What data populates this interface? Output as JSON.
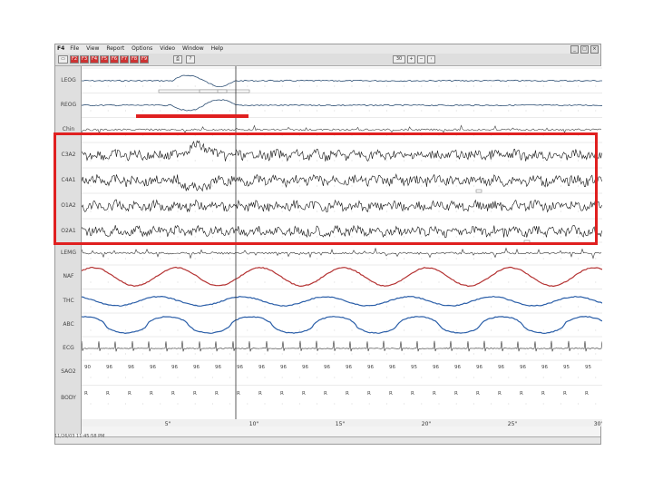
{
  "menu": {
    "app": "F4",
    "items": [
      "File",
      "View",
      "Report",
      "Options",
      "Video",
      "Window",
      "Help"
    ]
  },
  "toolbar": {
    "buttons": [
      "F2",
      "F3",
      "F4",
      "F5",
      "F6",
      "F7",
      "F8",
      "F9"
    ],
    "zoom_label": "30"
  },
  "channels": [
    {
      "label": "LEOG",
      "color": "#2c4e73"
    },
    {
      "label": "REOG",
      "color": "#2c4e73"
    },
    {
      "label": "Chin",
      "color": "#444444"
    },
    {
      "label": "C3A2",
      "color": "#111111"
    },
    {
      "label": "C4A1",
      "color": "#111111"
    },
    {
      "label": "O1A2",
      "color": "#111111"
    },
    {
      "label": "O2A1",
      "color": "#111111"
    },
    {
      "label": "LEMG",
      "color": "#333333"
    },
    {
      "label": "NAF",
      "color": "#b43232"
    },
    {
      "label": "THC",
      "color": "#2a5ea8"
    },
    {
      "label": "ABC",
      "color": "#2a5ea8"
    },
    {
      "label": "ECG",
      "color": "#333333"
    },
    {
      "label": "SAO2",
      "color": "#444444"
    },
    {
      "label": "BODY",
      "color": "#444444"
    }
  ],
  "sao2_values": [
    "90",
    "96",
    "96",
    "96",
    "96",
    "96",
    "96",
    "96",
    "96",
    "96",
    "96",
    "96",
    "96",
    "96",
    "96",
    "95",
    "96",
    "96",
    "96",
    "96",
    "96",
    "96",
    "95",
    "95"
  ],
  "body_values": [
    "R",
    "R",
    "R",
    "R",
    "R",
    "R",
    "R",
    "R",
    "R",
    "R",
    "R",
    "R",
    "R",
    "R",
    "R",
    "R",
    "R",
    "R",
    "R",
    "R",
    "R",
    "R",
    "R",
    "R"
  ],
  "time_ticks": [
    "5\"",
    "10\"",
    "15\"",
    "20\"",
    "25\"",
    "30\""
  ],
  "status_text": "11/26/03 11:45:58 PM",
  "highlight_color": "#e02020"
}
